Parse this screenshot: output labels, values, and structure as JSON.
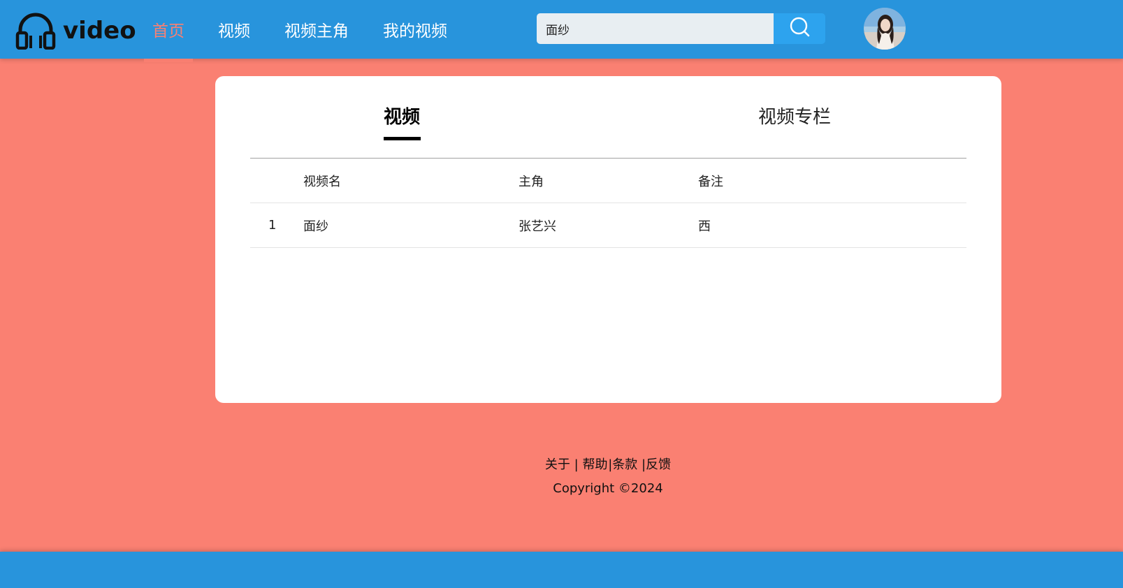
{
  "header": {
    "logo_text": "video",
    "nav": [
      {
        "label": "首页",
        "active": true
      },
      {
        "label": "视频",
        "active": false
      },
      {
        "label": "视频主角",
        "active": false
      },
      {
        "label": "我的视频",
        "active": false
      }
    ],
    "search": {
      "value": "面纱"
    }
  },
  "tabs": [
    {
      "label": "视频",
      "active": true
    },
    {
      "label": "视频专栏",
      "active": false
    }
  ],
  "table": {
    "headers": [
      "",
      "视频名",
      "主角",
      "备注"
    ],
    "rows": [
      [
        "1",
        "面纱",
        "张艺兴",
        "西"
      ]
    ]
  },
  "footer": {
    "links": [
      "关于",
      "帮助",
      "条款",
      "反馈"
    ],
    "separator": "|",
    "copyright": "Copyright ©2024"
  },
  "colors": {
    "header": "#2894dc",
    "background": "#fa8072",
    "active_nav": "#fa8072",
    "search_button": "#2da3ee"
  }
}
